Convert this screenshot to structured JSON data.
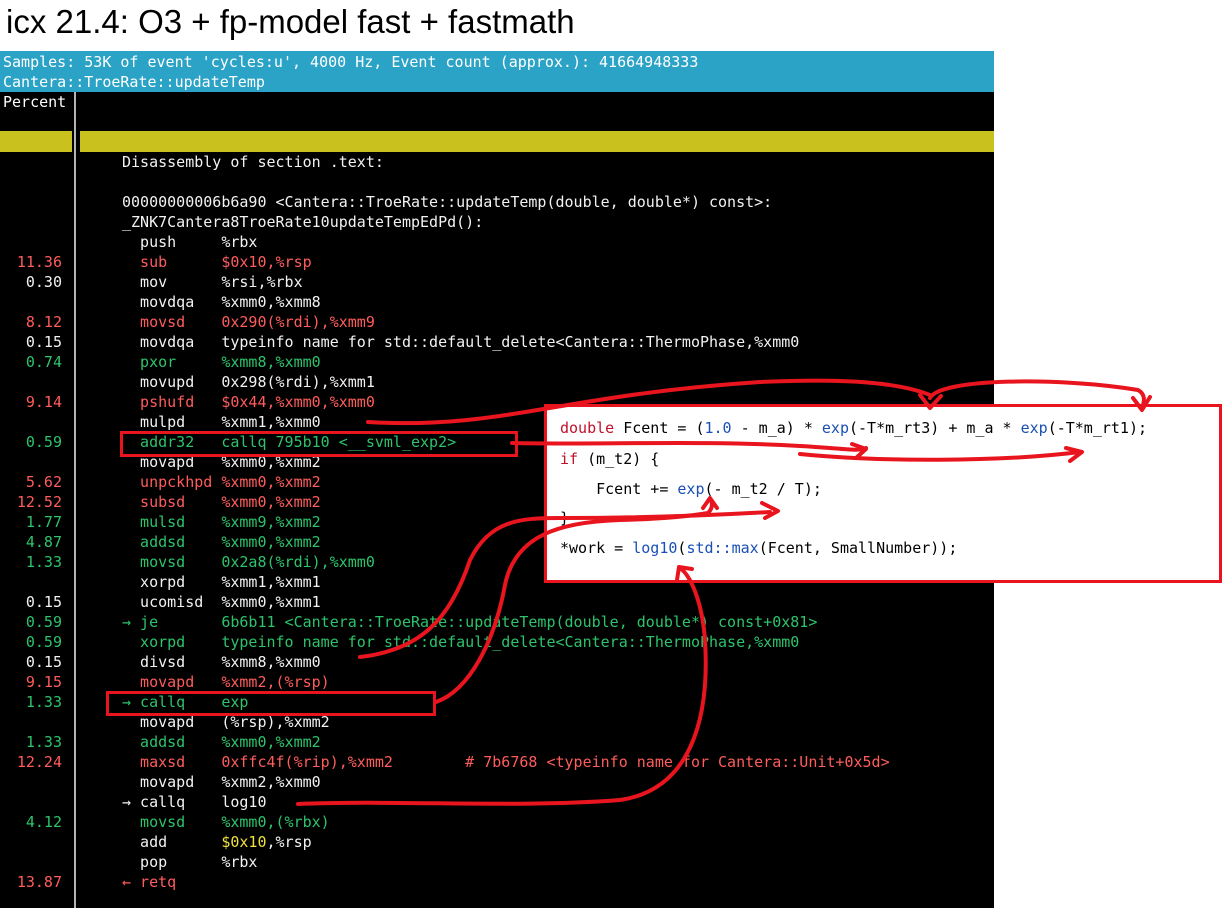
{
  "caption": "icx 21.4: O3 + fp-model fast + fastmath",
  "header": {
    "line1": "Samples: 53K of event 'cycles:u', 4000 Hz, Event count (approx.): 41664948333",
    "line2": "Cantera::TroeRate::updateTemp"
  },
  "percent_label": "Percent",
  "rows": [
    {
      "pct": "",
      "code": "Disassembly of section .text:",
      "color": "w"
    },
    {
      "pct": "",
      "code": "",
      "color": "w"
    },
    {
      "pct": "",
      "code": "00000000006b6a90 <Cantera::TroeRate::updateTemp(double, double*) const>:",
      "color": "w"
    },
    {
      "pct": "",
      "code": "_ZNK7Cantera8TroeRate10updateTempEdPd():",
      "color": "w"
    },
    {
      "pct": "",
      "code": "  push     %rbx",
      "color": "w"
    },
    {
      "pct": "11.36",
      "code": "  sub      $0x10,%rsp",
      "color": "r"
    },
    {
      "pct": "0.30",
      "code": "  mov      %rsi,%rbx",
      "color": "w"
    },
    {
      "pct": "",
      "code": "  movdqa   %xmm0,%xmm8",
      "color": "w"
    },
    {
      "pct": "8.12",
      "code": "  movsd    0x290(%rdi),%xmm9",
      "color": "r"
    },
    {
      "pct": "0.15",
      "code": "  movdqa   typeinfo name for std::default_delete<Cantera::ThermoPhase,%xmm0",
      "color": "w"
    },
    {
      "pct": "0.74",
      "code": "  pxor     %xmm8,%xmm0",
      "color": "g"
    },
    {
      "pct": "",
      "code": "  movupd   0x298(%rdi),%xmm1",
      "color": "w"
    },
    {
      "pct": "9.14",
      "code": "  pshufd   $0x44,%xmm0,%xmm0",
      "color": "r"
    },
    {
      "pct": "",
      "code": "  mulpd    %xmm1,%xmm0",
      "color": "w"
    },
    {
      "pct": "0.59",
      "code": "  addr32   callq 795b10 <__svml_exp2>",
      "color": "g"
    },
    {
      "pct": "",
      "code": "  movapd   %xmm0,%xmm2",
      "color": "w"
    },
    {
      "pct": "5.62",
      "code": "  unpckhpd %xmm0,%xmm2",
      "color": "r"
    },
    {
      "pct": "12.52",
      "code": "  subsd    %xmm0,%xmm2",
      "color": "r"
    },
    {
      "pct": "1.77",
      "code": "  mulsd    %xmm9,%xmm2",
      "color": "g"
    },
    {
      "pct": "4.87",
      "code": "  addsd    %xmm0,%xmm2",
      "color": "g"
    },
    {
      "pct": "1.33",
      "code": "  movsd    0x2a8(%rdi),%xmm0",
      "color": "g"
    },
    {
      "pct": "",
      "code": "  xorpd    %xmm1,%xmm1",
      "color": "w"
    },
    {
      "pct": "0.15",
      "code": "  ucomisd  %xmm0,%xmm1",
      "color": "w"
    },
    {
      "pct": "0.59",
      "code": "→ je       6b6b11 <Cantera::TroeRate::updateTemp(double, double*) const+0x81>",
      "color": "g"
    },
    {
      "pct": "0.59",
      "code": "  xorpd    typeinfo name for std::default_delete<Cantera::ThermoPhase,%xmm0",
      "color": "g"
    },
    {
      "pct": "0.15",
      "code": "  divsd    %xmm8,%xmm0",
      "color": "w"
    },
    {
      "pct": "9.15",
      "code": "  movapd   %xmm2,(%rsp)",
      "color": "r"
    },
    {
      "pct": "1.33",
      "code": "→ callq    exp",
      "color": "g"
    },
    {
      "pct": "",
      "code": "  movapd   (%rsp),%xmm2",
      "color": "w"
    },
    {
      "pct": "1.33",
      "code": "  addsd    %xmm0,%xmm2",
      "color": "g"
    },
    {
      "pct": "12.24",
      "code": "  maxsd    0xffc4f(%rip),%xmm2        # 7b6768 <typeinfo name for Cantera::Unit+0x5d>",
      "color": "r"
    },
    {
      "pct": "",
      "code": "  movapd   %xmm2,%xmm0",
      "color": "w"
    },
    {
      "pct": "",
      "code": "→ callq    log10",
      "color": "w"
    },
    {
      "pct": "4.12",
      "code": "  movsd    %xmm0,(%rbx)",
      "color": "g"
    },
    {
      "pct": "",
      "code": "  add      $0x10,%rsp",
      "color": "w"
    },
    {
      "pct": "",
      "code": "  pop      %rbx",
      "color": "w"
    },
    {
      "pct": "13.87",
      "code": "← retq",
      "color": "r"
    }
  ],
  "source": {
    "line1": "double Fcent = (1.0 - m_a) * exp(-T*m_rt3) + m_a * exp(-T*m_rt1);",
    "line2": "if (m_t2) {",
    "line3": "    Fcent += exp(- m_t2 / T);",
    "line4": "}",
    "line5": "*work = log10(std::max(Fcent, SmallNumber));"
  },
  "colors": {
    "header_bg": "#2ba3c6",
    "hot_red": "#ff5c5c",
    "warm_green": "#2dc36b",
    "annotation_red": "#e8141e",
    "yellow_bar": "#c9c21e"
  }
}
